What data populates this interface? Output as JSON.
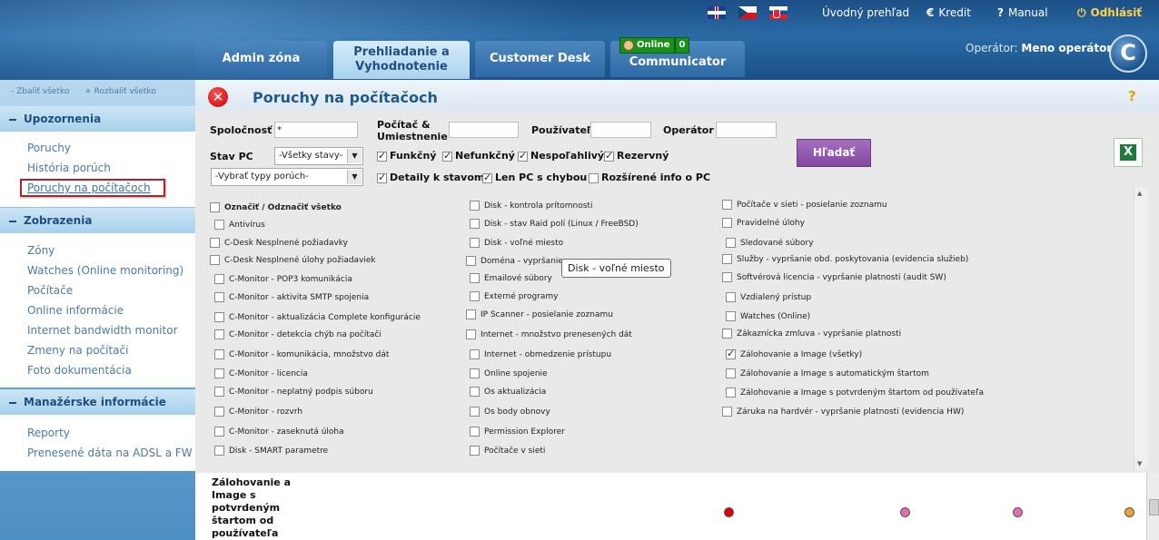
{
  "header": {
    "languages": [
      "EN",
      "CZ",
      "SK"
    ],
    "links": {
      "home": "Úvodný prehľad",
      "credit": "Kredit",
      "manual": "Manual",
      "logout": "Odhlásiť"
    },
    "tabs": {
      "admin": "Admin zóna",
      "overview_line1": "Prehliadanie a",
      "overview_line2": "Vyhodnotenie",
      "desk": "Customer Desk",
      "communicator": "Communicator"
    },
    "online_label": "Online",
    "online_count": "0",
    "operator_label": "Operátor:",
    "operator_name": "Meno operátora",
    "logo_letter": "C"
  },
  "sidebar": {
    "collapse_all": "- Zbaliť všetko",
    "expand_all": "+ Rozbaliť všetko",
    "sections": [
      {
        "title": "Upozornenia",
        "items": [
          "Poruchy",
          "História porúch",
          "Poruchy na počítačoch"
        ]
      },
      {
        "title": "Zobrazenia",
        "items": [
          "Zóny",
          "Watches (Online monitoring)",
          "Počítače",
          "Online informácie",
          "Internet bandwidth monitor",
          "Zmeny na počítači",
          "Foto dokumentácia"
        ]
      },
      {
        "title": "Manažérske informácie",
        "items": [
          "Reporty",
          "Prenesené dáta na ADSL a FW"
        ]
      }
    ],
    "selected_item": "Poruchy na počítačoch"
  },
  "main": {
    "title": "Poruchy na počítačoch",
    "help": "?",
    "filters": {
      "company_label": "Spoločnosť",
      "company_value": "*",
      "computer_label_1": "Počítač &",
      "computer_label_2": "Umiestnenie",
      "computer_value": "",
      "user_label": "Používateľ",
      "user_value": "",
      "operator_label": "Operátor",
      "operator_value": "",
      "pc_state_label": "Stav PC",
      "pc_state_value": "-Všetky stavy-",
      "fault_type_value": "-Vybrať typy porúch-",
      "checks": [
        {
          "label": "Funkčný",
          "checked": true
        },
        {
          "label": "Nefunkčný",
          "checked": true
        },
        {
          "label": "Nespoľahlivý",
          "checked": true
        },
        {
          "label": "Rezervný",
          "checked": true
        },
        {
          "label": "Detaily k stavom",
          "checked": true
        },
        {
          "label": "Len PC s chybou",
          "checked": true
        },
        {
          "label": "Rozšírené info o PC",
          "checked": false
        }
      ],
      "search_button": "Hľadať"
    },
    "fault_columns": [
      [
        {
          "label": "Označiť / Odznačiť všetko",
          "checked": false
        },
        {
          "label": "Antivírus",
          "checked": false
        },
        {
          "label": "C-Desk Nesplnené požiadavky",
          "checked": false
        },
        {
          "label": "C-Desk Nesplnené úlohy požiadaviek",
          "checked": false
        },
        {
          "label": "C-Monitor - POP3 komunikácia",
          "checked": false
        },
        {
          "label": "C-Monitor - aktivita SMTP spojenia",
          "checked": false
        },
        {
          "label": "C-Monitor - aktualizácia Complete konfigurácie",
          "checked": false
        },
        {
          "label": "C-Monitor - detekcia chýb na počítači",
          "checked": false
        },
        {
          "label": "C-Monitor - komunikácia, množstvo dát",
          "checked": false
        },
        {
          "label": "C-Monitor - licencia",
          "checked": false
        },
        {
          "label": "C-Monitor - neplatný podpis súboru",
          "checked": false
        },
        {
          "label": "C-Monitor - rozvrh",
          "checked": false
        },
        {
          "label": "C-Monitor - zaseknutá úloha",
          "checked": false
        },
        {
          "label": "Disk - SMART parametre",
          "checked": false
        }
      ],
      [
        {
          "label": "Disk - kontrola prítomnosti",
          "checked": false
        },
        {
          "label": "Disk - stav Raid polí (Linux / FreeBSD)",
          "checked": false
        },
        {
          "label": "Disk - voľné miesto",
          "checked": false
        },
        {
          "label": "Doména - vypršanie",
          "checked": false
        },
        {
          "label": "Emailové súbory",
          "checked": false
        },
        {
          "label": "Externé programy",
          "checked": false
        },
        {
          "label": "IP Scanner - posielanie zoznamu",
          "checked": false
        },
        {
          "label": "Internet - množstvo prenesených dát",
          "checked": false
        },
        {
          "label": "Internet - obmedzenie prístupu",
          "checked": false
        },
        {
          "label": "Online spojenie",
          "checked": false
        },
        {
          "label": "Os aktualizácia",
          "checked": false
        },
        {
          "label": "Os body obnovy",
          "checked": false
        },
        {
          "label": "Permission Explorer",
          "checked": false
        },
        {
          "label": "Počítače v sieti",
          "checked": false
        }
      ],
      [
        {
          "label": "Počítače v sieti - posielanie zoznamu",
          "checked": false
        },
        {
          "label": "Pravidelné úlohy",
          "checked": false
        },
        {
          "label": "Sledované súbory",
          "checked": false
        },
        {
          "label": "Služby - vypršanie obd. poskytovania (evidencia služieb)",
          "checked": false
        },
        {
          "label": "Softvérová licencia - vypršanie platnosti (audit SW)",
          "checked": false
        },
        {
          "label": "Vzdialený prístup",
          "checked": false
        },
        {
          "label": "Watches (Online)",
          "checked": false
        },
        {
          "label": "Zákaznícka zmluva - vypršanie platnosti",
          "checked": false
        },
        {
          "label": "Zálohovanie a Image (všetky)",
          "checked": true
        },
        {
          "label": "Zálohovanie a Image s automatickým štartom",
          "checked": false
        },
        {
          "label": "Zálohovanie a Image s potvrdeným štartom od používateľa",
          "checked": false
        },
        {
          "label": "Záruka na hardvér - vypršanie platnosti (evidencia HW)",
          "checked": false
        }
      ]
    ],
    "tooltip": "Disk - voľné miesto",
    "result": {
      "label": "Zálohovanie a Image s potvrdeným štartom od používateľa",
      "dots": [
        {
          "color": "#e00000"
        },
        {
          "color": "#e070b0"
        },
        {
          "color": "#e070b0"
        },
        {
          "color": "#f0a030"
        }
      ]
    }
  }
}
